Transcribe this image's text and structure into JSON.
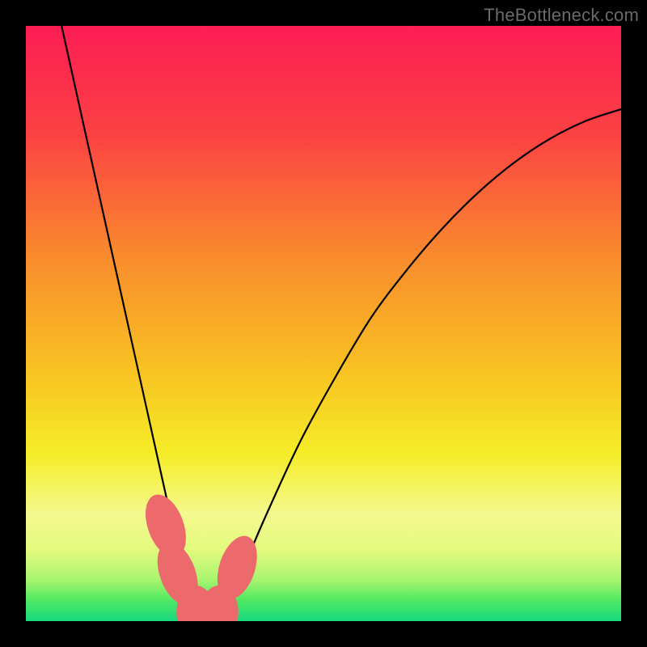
{
  "watermark": "TheBottleneck.com",
  "chart_data": {
    "type": "line",
    "title": "",
    "xlabel": "",
    "ylabel": "",
    "xlim": [
      0,
      100
    ],
    "ylim": [
      0,
      100
    ],
    "grid": false,
    "series": [
      {
        "name": "bottleneck-curve",
        "x": [
          6,
          10,
          14,
          18,
          22,
          24,
          26,
          28,
          30,
          32,
          34,
          40,
          46,
          52,
          58,
          64,
          70,
          76,
          82,
          88,
          94,
          100
        ],
        "y": [
          100,
          82,
          64,
          46,
          28,
          19,
          10,
          3,
          0,
          0,
          3,
          17,
          30,
          41,
          51,
          59,
          66,
          72,
          77,
          81,
          84,
          86
        ],
        "stroke": "#000000",
        "stroke_width": 2.2
      }
    ],
    "markers": [
      {
        "name": "marker-left-1",
        "x": 23.5,
        "y": 16,
        "rx": 3.0,
        "ry": 5.5,
        "rotation": -20,
        "fill": "#ed6a6c"
      },
      {
        "name": "marker-left-2",
        "x": 25.5,
        "y": 8,
        "rx": 3.0,
        "ry": 5.5,
        "rotation": -20,
        "fill": "#ed6a6c"
      },
      {
        "name": "marker-bottom-1",
        "x": 28.5,
        "y": 1.5,
        "rx": 3.2,
        "ry": 4.5,
        "rotation": 0,
        "fill": "#ed6a6c"
      },
      {
        "name": "marker-bottom-2",
        "x": 32.5,
        "y": 1.5,
        "rx": 3.2,
        "ry": 4.5,
        "rotation": 0,
        "fill": "#ed6a6c"
      },
      {
        "name": "marker-right-1",
        "x": 35.5,
        "y": 9,
        "rx": 3.0,
        "ry": 5.5,
        "rotation": 18,
        "fill": "#ed6a6c"
      }
    ],
    "background_gradient": {
      "type": "vertical",
      "stops": [
        {
          "offset": 0.0,
          "color": "#fc1d54"
        },
        {
          "offset": 0.18,
          "color": "#fb4143"
        },
        {
          "offset": 0.4,
          "color": "#f98f2c"
        },
        {
          "offset": 0.58,
          "color": "#f8c222"
        },
        {
          "offset": 0.72,
          "color": "#f5ed28"
        },
        {
          "offset": 0.82,
          "color": "#f4f98e"
        },
        {
          "offset": 0.88,
          "color": "#e3fa7e"
        },
        {
          "offset": 0.93,
          "color": "#a9f56f"
        },
        {
          "offset": 0.965,
          "color": "#50e862"
        },
        {
          "offset": 1.0,
          "color": "#18d981"
        }
      ]
    }
  }
}
